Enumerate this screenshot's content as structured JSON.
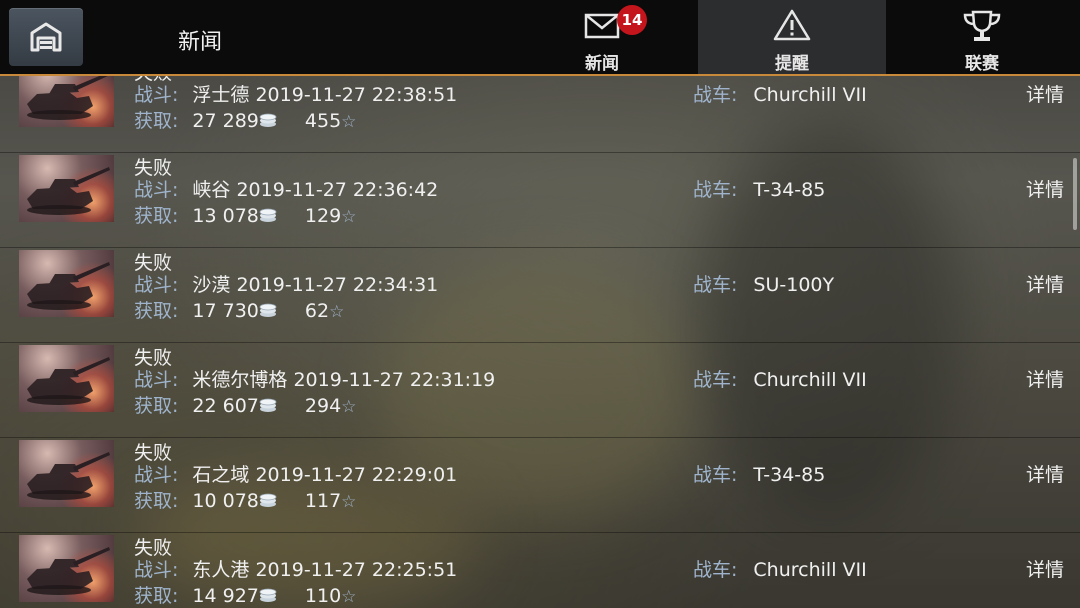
{
  "header": {
    "title": "新闻",
    "tabs": [
      {
        "label": "新闻",
        "badge": "14",
        "icon": "mail-icon"
      },
      {
        "label": "提醒",
        "icon": "warning-icon",
        "active": true
      },
      {
        "label": "联赛",
        "icon": "trophy-icon"
      }
    ]
  },
  "labels": {
    "battle": "战斗:",
    "reward": "获取:",
    "vehicle": "战车:",
    "details": "详情"
  },
  "battles": [
    {
      "result": "失败",
      "map": "浮士德",
      "datetime": "2019-11-27 22:38:51",
      "credits": "27 289",
      "xp": "455",
      "vehicle": "Churchill VII"
    },
    {
      "result": "失败",
      "map": "峡谷",
      "datetime": "2019-11-27 22:36:42",
      "credits": "13 078",
      "xp": "129",
      "vehicle": "T-34-85"
    },
    {
      "result": "失败",
      "map": "沙漠",
      "datetime": "2019-11-27 22:34:31",
      "credits": "17 730",
      "xp": "62",
      "vehicle": "SU-100Y"
    },
    {
      "result": "失败",
      "map": "米德尔博格",
      "datetime": "2019-11-27 22:31:19",
      "credits": "22 607",
      "xp": "294",
      "vehicle": "Churchill VII"
    },
    {
      "result": "失败",
      "map": "石之域",
      "datetime": "2019-11-27 22:29:01",
      "credits": "10 078",
      "xp": "117",
      "vehicle": "T-34-85"
    },
    {
      "result": "失败",
      "map": "东人港",
      "datetime": "2019-11-27 22:25:51",
      "credits": "14 927",
      "xp": "110",
      "vehicle": "Churchill VII"
    }
  ],
  "colors": {
    "accent": "#c88a3a",
    "label": "#9fb4cc",
    "badge": "#c4151c"
  }
}
